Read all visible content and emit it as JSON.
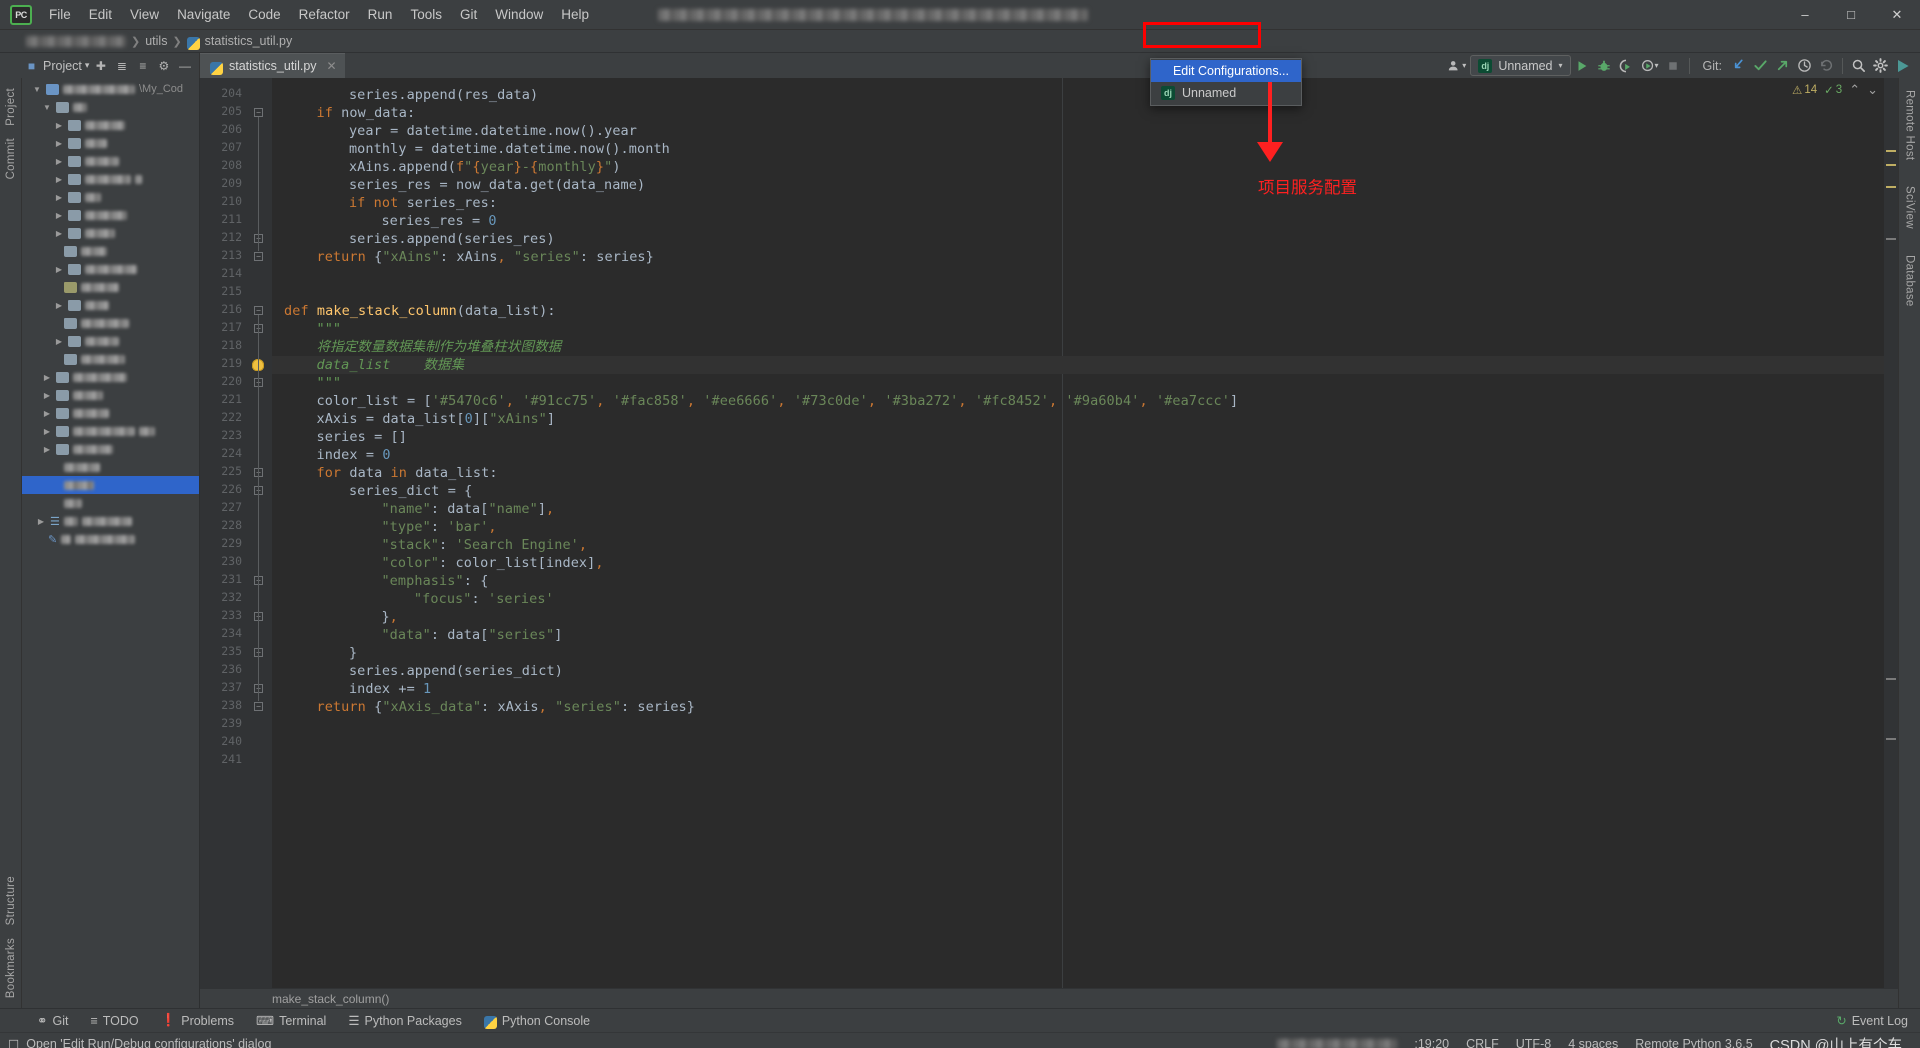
{
  "window": {
    "title_blurred": true,
    "minimize_label": "–",
    "maximize_label": "□",
    "close_label": "✕"
  },
  "menubar": {
    "logo_text": "PC",
    "items": [
      {
        "label": "File"
      },
      {
        "label": "Edit"
      },
      {
        "label": "View"
      },
      {
        "label": "Navigate"
      },
      {
        "label": "Code"
      },
      {
        "label": "Refactor"
      },
      {
        "label": "Run"
      },
      {
        "label": "Tools"
      },
      {
        "label": "Git"
      },
      {
        "label": "Window"
      },
      {
        "label": "Help"
      }
    ]
  },
  "breadcrumb": {
    "project_blurred": true,
    "folder": "utils",
    "file": "statistics_util.py",
    "sep": "❯"
  },
  "project_panel": {
    "title": "Project",
    "caret": "▾",
    "icons": [
      "locate-icon",
      "collapse-all-icon",
      "expand-icon",
      "settings-icon",
      "hide-icon"
    ],
    "partial_path": "\\My_Cod"
  },
  "editor_tab": {
    "filename": "statistics_util.py",
    "close": "✕"
  },
  "run_config": {
    "icon_text": "dj",
    "name": "Unnamed",
    "caret": "▾"
  },
  "dropdown": {
    "items": [
      {
        "label": "Edit Configurations...",
        "highlighted": true
      },
      {
        "label": "Unnamed",
        "icon_text": "dj",
        "highlighted": false
      }
    ]
  },
  "toolbar": {
    "user_icon": "user-icon",
    "run_label": "Run",
    "debug_label": "Debug",
    "coverage_label": "Run with Coverage",
    "profile_label": "Profile",
    "stop_label": "Stop",
    "git_label": "Git:",
    "update_label": "Update Project",
    "commit_label": "Commit",
    "push_label": "Push",
    "history_label": "History",
    "rollback_label": "Rollback",
    "search_label": "Search Everywhere",
    "settings_label": "Settings"
  },
  "inspections": {
    "warning_count": "14",
    "warning_icon": "⚠",
    "ok_count": "3",
    "ok_icon": "✓",
    "up_arrow": "⌃",
    "down_arrow": "⌄"
  },
  "left_rail": {
    "project": "Project",
    "commit": "Commit",
    "structure": "Structure",
    "bookmarks": "Bookmarks"
  },
  "right_rail": {
    "remote_host": "Remote Host",
    "sciview": "SciView",
    "database": "Database"
  },
  "editor_footer": {
    "context": "make_stack_column()"
  },
  "code": {
    "first_line": 204,
    "last_line": 241,
    "current_line": 219,
    "lines": [
      {
        "n": 204,
        "indent": 8,
        "text": "series.append(res_data)"
      },
      {
        "n": 205,
        "indent": 4,
        "text": "if now_data:"
      },
      {
        "n": 206,
        "indent": 8,
        "text": "year = datetime.datetime.now().year"
      },
      {
        "n": 207,
        "indent": 8,
        "text": "monthly = datetime.datetime.now().month"
      },
      {
        "n": 208,
        "indent": 8,
        "text": "xAins.append(f\"{year}-{monthly}\")"
      },
      {
        "n": 209,
        "indent": 8,
        "text": "series_res = now_data.get(data_name)"
      },
      {
        "n": 210,
        "indent": 8,
        "text": "if not series_res:"
      },
      {
        "n": 211,
        "indent": 12,
        "text": "series_res = 0"
      },
      {
        "n": 212,
        "indent": 8,
        "text": "series.append(series_res)"
      },
      {
        "n": 213,
        "indent": 4,
        "text": "return {\"xAins\": xAins, \"series\": series}"
      },
      {
        "n": 214,
        "indent": 0,
        "text": ""
      },
      {
        "n": 215,
        "indent": 0,
        "text": ""
      },
      {
        "n": 216,
        "indent": 0,
        "text": "def make_stack_column(data_list):"
      },
      {
        "n": 217,
        "indent": 4,
        "text": "\"\"\""
      },
      {
        "n": 218,
        "indent": 4,
        "text": "将指定数量数据集制作为堆叠柱状图数据"
      },
      {
        "n": 219,
        "indent": 4,
        "text": "data_list    数据集"
      },
      {
        "n": 220,
        "indent": 4,
        "text": "\"\"\""
      },
      {
        "n": 221,
        "indent": 4,
        "text": "color_list = ['#5470c6', '#91cc75', '#fac858', '#ee6666', '#73c0de', '#3ba272', '#fc8452', '#9a60b4', '#ea7ccc']"
      },
      {
        "n": 222,
        "indent": 4,
        "text": "xAxis = data_list[0][\"xAins\"]"
      },
      {
        "n": 223,
        "indent": 4,
        "text": "series = []"
      },
      {
        "n": 224,
        "indent": 4,
        "text": "index = 0"
      },
      {
        "n": 225,
        "indent": 4,
        "text": "for data in data_list:"
      },
      {
        "n": 226,
        "indent": 8,
        "text": "series_dict = {"
      },
      {
        "n": 227,
        "indent": 12,
        "text": "\"name\": data[\"name\"],"
      },
      {
        "n": 228,
        "indent": 12,
        "text": "\"type\": 'bar',"
      },
      {
        "n": 229,
        "indent": 12,
        "text": "\"stack\": 'Search Engine',"
      },
      {
        "n": 230,
        "indent": 12,
        "text": "\"color\": color_list[index],"
      },
      {
        "n": 231,
        "indent": 12,
        "text": "\"emphasis\": {"
      },
      {
        "n": 232,
        "indent": 16,
        "text": "\"focus\": 'series'"
      },
      {
        "n": 233,
        "indent": 12,
        "text": "},"
      },
      {
        "n": 234,
        "indent": 12,
        "text": "\"data\": data[\"series\"]"
      },
      {
        "n": 235,
        "indent": 8,
        "text": "}"
      },
      {
        "n": 236,
        "indent": 8,
        "text": "series.append(series_dict)"
      },
      {
        "n": 237,
        "indent": 8,
        "text": "index += 1"
      },
      {
        "n": 238,
        "indent": 4,
        "text": "return {\"xAxis_data\": xAxis, \"series\": series}"
      },
      {
        "n": 239,
        "indent": 0,
        "text": ""
      },
      {
        "n": 240,
        "indent": 0,
        "text": ""
      },
      {
        "n": 241,
        "indent": 0,
        "text": ""
      }
    ]
  },
  "bottom_bar": {
    "items": [
      {
        "label": "Git",
        "icon": "git-branch-icon"
      },
      {
        "label": "TODO",
        "icon": "todo-list-icon"
      },
      {
        "label": "Problems",
        "icon": "problems-icon"
      },
      {
        "label": "Terminal",
        "icon": "terminal-icon"
      },
      {
        "label": "Python Packages",
        "icon": "packages-icon"
      },
      {
        "label": "Python Console",
        "icon": "python-console-icon"
      }
    ],
    "event_log": "Event Log",
    "event_log_icon": "↻"
  },
  "statusbar": {
    "hint": "Open 'Edit Run/Debug configurations' dialog",
    "hint_icon": "dialog-icon",
    "caret_position": ":19:20",
    "line_separator": "CRLF",
    "encoding": "UTF-8",
    "indent": "4 spaces",
    "interpreter": "Remote Python 3.6.5",
    "watermark": "CSDN @山上有个车"
  },
  "annotations": {
    "note_cn": "项目服务配置",
    "redbox_color": "#ff0000",
    "arrow_color": "#ff2020"
  },
  "colors": {
    "bg_ide": "#3c3f41",
    "bg_editor": "#2b2b2b",
    "gutter": "#313335",
    "accent_blue": "#2f65ca",
    "keyword": "#cc7832",
    "string": "#6a8759",
    "number": "#6897bb",
    "function": "#ffc66d",
    "comment": "#629755",
    "text": "#a9b7c6"
  }
}
